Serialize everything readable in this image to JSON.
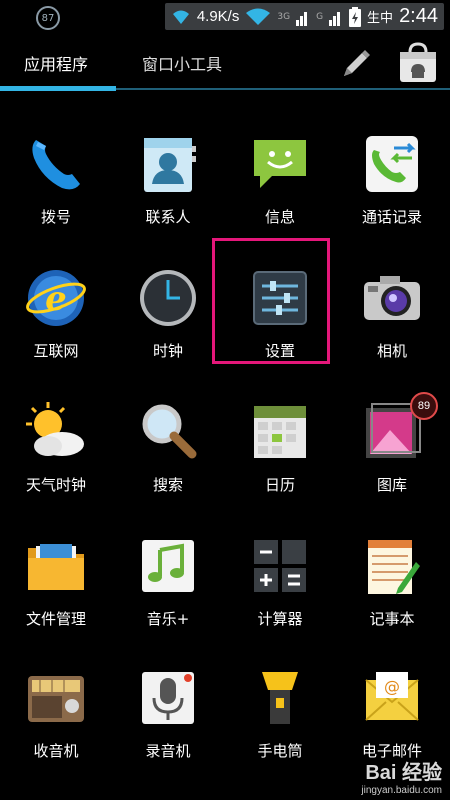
{
  "status_bar": {
    "notification_count": "87",
    "speed": "4.9K/s",
    "network_label": "3G",
    "network_label_2": "G",
    "carrier_text": "生中",
    "time": "2:44"
  },
  "tabs": {
    "apps": "应用程序",
    "widgets": "窗口小工具"
  },
  "apps": [
    {
      "label": "拨号",
      "icon": "phone-icon"
    },
    {
      "label": "联系人",
      "icon": "contacts-icon"
    },
    {
      "label": "信息",
      "icon": "messaging-icon"
    },
    {
      "label": "通话记录",
      "icon": "call-log-icon"
    },
    {
      "label": "互联网",
      "icon": "browser-icon"
    },
    {
      "label": "时钟",
      "icon": "clock-icon"
    },
    {
      "label": "设置",
      "icon": "settings-icon"
    },
    {
      "label": "相机",
      "icon": "camera-icon"
    },
    {
      "label": "天气时钟",
      "icon": "weather-clock-icon"
    },
    {
      "label": "搜索",
      "icon": "search-icon"
    },
    {
      "label": "日历",
      "icon": "calendar-icon"
    },
    {
      "label": "图库",
      "icon": "gallery-icon",
      "badge": "89"
    },
    {
      "label": "文件管理",
      "icon": "file-manager-icon"
    },
    {
      "label": "音乐+",
      "icon": "music-icon"
    },
    {
      "label": "计算器",
      "icon": "calculator-icon"
    },
    {
      "label": "记事本",
      "icon": "notepad-icon"
    },
    {
      "label": "收音机",
      "icon": "radio-icon"
    },
    {
      "label": "录音机",
      "icon": "recorder-icon"
    },
    {
      "label": "手电筒",
      "icon": "flashlight-icon"
    },
    {
      "label": "电子邮件",
      "icon": "email-icon"
    }
  ],
  "watermark": {
    "logo": "Bai 经验",
    "url": "jingyan.baidu.com"
  },
  "colors": {
    "tab_accent": "#33b5e5",
    "highlight": "#e5177a"
  }
}
